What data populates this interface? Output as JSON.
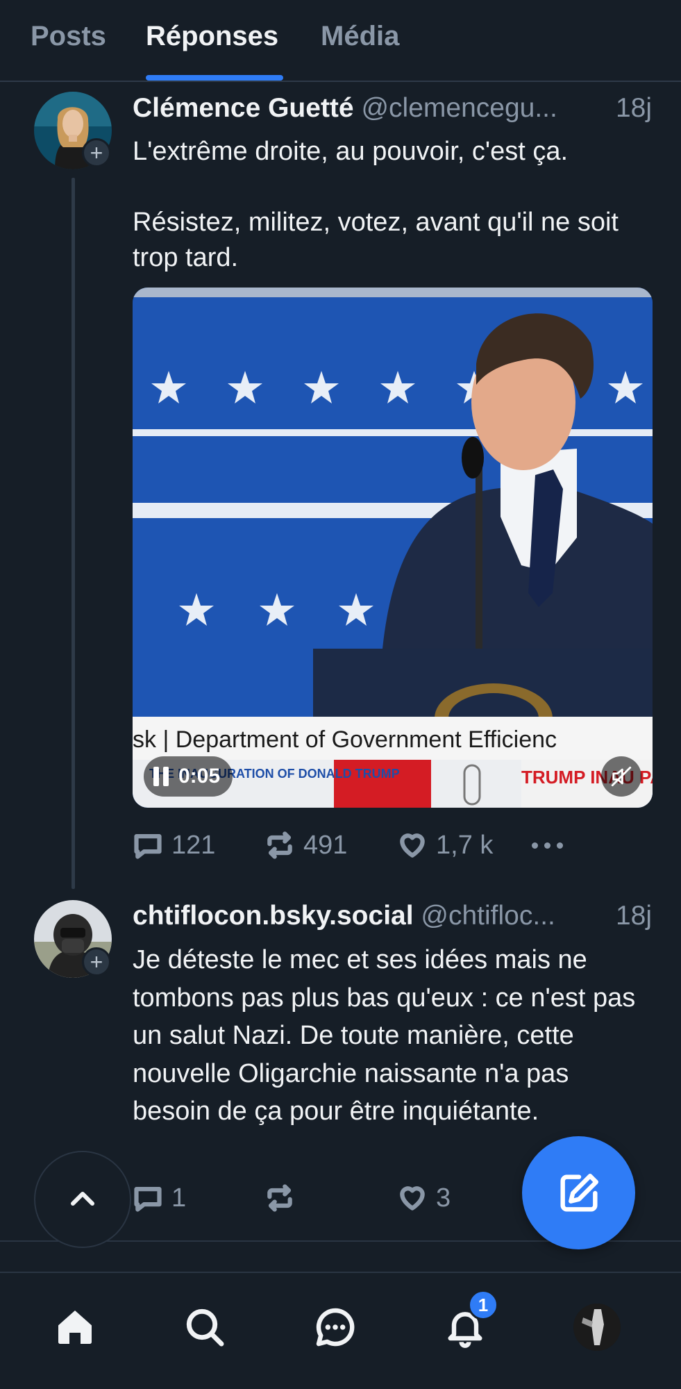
{
  "tabs": [
    {
      "label": "Posts",
      "active": false
    },
    {
      "label": "Réponses",
      "active": true
    },
    {
      "label": "Média",
      "active": false
    }
  ],
  "posts": [
    {
      "display_name": "Clémence Guetté",
      "handle": "@clemencegu...",
      "time": "18j",
      "text": "L'extrême droite, au pouvoir, c'est ça.\n\nRésistez, militez, votez, avant qu'il ne soit trop tard.",
      "video": {
        "duration": "0:05",
        "lower_third": "sk | Department of Government Efficienc",
        "ticker_left": "THE INAUGURATION OF DONALD TRUMP",
        "ticker_right": "TRUMP INAU PARADE M"
      },
      "stats": {
        "replies": "121",
        "reposts": "491",
        "likes": "1,7 k"
      }
    },
    {
      "display_name": "chtiflocon.bsky.social",
      "handle": "@chtifloc...",
      "time": "18j",
      "text": "Je déteste le mec et ses idées mais ne tombons pas plus bas qu'eux : ce n'est pas un salut Nazi. De toute manière, cette nouvelle Oligarchie naissante n'a pas besoin de ça pour être inquiétante.",
      "stats": {
        "replies": "1",
        "reposts": "",
        "likes": "3"
      }
    }
  ],
  "nav": {
    "items": [
      "home-icon",
      "search-icon",
      "chat-icon",
      "bell-icon",
      "profile-avatar"
    ],
    "notifications_badge": "1"
  },
  "colors": {
    "background": "#161e27",
    "accent": "#2f7cf6",
    "muted_text": "#8a97a7"
  }
}
